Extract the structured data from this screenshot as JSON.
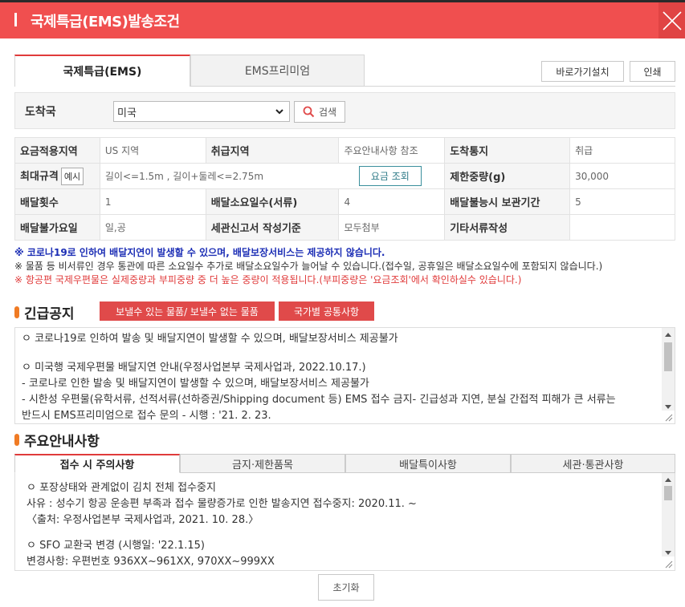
{
  "window": {
    "title": "국제특급(EMS)발송조건"
  },
  "tabs": {
    "ems": "국제특급(EMS)",
    "premium": "EMS프리미엄"
  },
  "buttons": {
    "shortcut": "바로가기설치",
    "print": "인쇄",
    "search": "검색",
    "example": "예시",
    "fee_lookup": "요금 조회",
    "reset": "초기화"
  },
  "destination": {
    "label": "도착국",
    "selected": "미국"
  },
  "info": {
    "r1": {
      "h1": "요금적용지역",
      "v1": "US 지역",
      "h2": "취급지역",
      "v2": "주요안내사항 참조",
      "h3": "도착통지",
      "v3": "취급"
    },
    "r2": {
      "h1": "최대규격",
      "v1": "길이<=1.5m , 길이+둘레<=2.75m",
      "h3": "제한중량(g)",
      "v3": "30,000"
    },
    "r3": {
      "h1": "배달횟수",
      "v1": "1",
      "h2": "배달소요일수(서류)",
      "v2": "4",
      "h3": "배달불능시 보관기간",
      "v3": "5"
    },
    "r4": {
      "h1": "배달불가요일",
      "v1": "일,공",
      "h2": "세관신고서 작성기준",
      "v2": "모두첨부",
      "h3": "기타서류작성",
      "v3": ""
    }
  },
  "notes": {
    "n1": "※ 코로나19로 인하여 배달지연이 발생할 수 있으며, 배달보장서비스는 제공하지 않습니다.",
    "n2": "※ 물품 등 비서류인 경우 통관에 따른 소요일수 추가로 배달소요일수가 늘어날 수 있습니다.(접수일, 공휴일은 배달소요일수에 포함되지 않습니다.)",
    "n3": "※ 항공편 국제우편물은 실제중량과 부피중량 중 더 높은 중량이 적용됩니다.(부피중량은 '요금조회'에서 확인하실수 있습니다.)"
  },
  "urgent": {
    "title": "긴급공지",
    "btn1": "보낼수 있는 물품/ 보낼수 없는 물품",
    "btn2": "국가별 공통사항",
    "lines": [
      "ㅇ 코로나19로 인하여 발송 및 배달지연이 발생할 수 있으며, 배달보장서비스 제공불가",
      "ㅇ  미국행 국제우편물 배달지연 안내(우정사업본부 국제사업과, 2022.10.17.)",
      " - 코로나로 인한 발송 및 배달지연이 발생할 수 있으며, 배달보장서비스 제공불가",
      " - 시한성 우편물(유학서류, 선적서류(선하증권/Shipping document 등) EMS 접수 금지- 긴급성과 지연, 분실 간접적 피해가 큰 서류는",
      "반드시 EMS프리미엄으로 접수 문의 - 시행 : '21. 2. 23."
    ]
  },
  "main_info": {
    "title": "주요안내사항",
    "tabs": [
      "접수 시 주의사항",
      "금지·제한품목",
      "배달특이사항",
      "세관·통관사항"
    ],
    "lines": [
      " ㅇ 포장상태와 관계없이 김치 전체 접수중지",
      " 사유 : 성수기 항공 운송편 부족과 접수 물량증가로 인한 발송지연 접수중지: 2020.11. ~",
      "〈출처: 우정사업본부 국제사업과, 2021. 10. 28.〉",
      " ㅇ SFO 교환국 변경 (시행일: '22.1.15)",
      " 변경사항: 우편번호 936XX~961XX, 970XX~999XX"
    ]
  },
  "colors": {
    "accent": "#f04f4f",
    "link_blue": "#1c2eb5",
    "notice_red": "#e03b3b"
  }
}
